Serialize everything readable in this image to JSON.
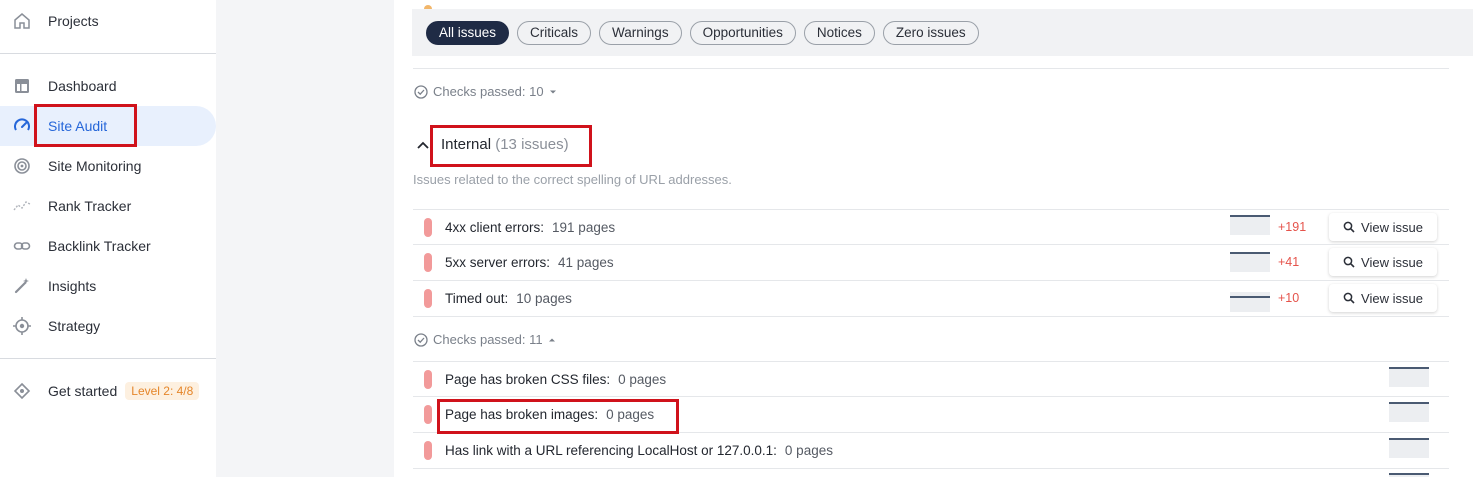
{
  "sidebar": {
    "items": [
      {
        "label": "Projects",
        "icon": "home-icon"
      },
      {
        "label": "Dashboard",
        "icon": "table-icon"
      },
      {
        "label": "Site Audit",
        "icon": "gauge-icon",
        "active": true
      },
      {
        "label": "Site Monitoring",
        "icon": "radar-icon"
      },
      {
        "label": "Rank Tracker",
        "icon": "trend-icon"
      },
      {
        "label": "Backlink Tracker",
        "icon": "link-icon"
      },
      {
        "label": "Insights",
        "icon": "magic-wand-icon"
      },
      {
        "label": "Strategy",
        "icon": "target-icon"
      },
      {
        "label": "Get started",
        "icon": "diamond-icon"
      }
    ],
    "level_badge": "Level 2: 4/8"
  },
  "filters": [
    "All issues",
    "Criticals",
    "Warnings",
    "Opportunities",
    "Notices",
    "Zero issues"
  ],
  "checks_prev": "Checks passed: 10",
  "section": {
    "title": "Internal",
    "count": "(13 issues)",
    "description": "Issues related to the correct spelling of URL addresses."
  },
  "issues": [
    {
      "label": "4xx client errors:",
      "pages": "191 pages",
      "delta": "+191"
    },
    {
      "label": "5xx server errors:",
      "pages": "41 pages",
      "delta": "+41"
    },
    {
      "label": "Timed out:",
      "pages": "10 pages",
      "delta": "+10"
    }
  ],
  "view_issue_label": "View issue",
  "checks_current": "Checks passed: 11",
  "passed": [
    {
      "label": "Page has broken CSS files:",
      "pages": "0 pages"
    },
    {
      "label": "Page has broken images:",
      "pages": "0 pages"
    },
    {
      "label": "Has link with a URL referencing LocalHost or 127.0.0.1:",
      "pages": "0 pages"
    }
  ],
  "colors": {
    "accent": "#2566d9",
    "critical": "#f29a9a",
    "delta": "#e5534b",
    "highlight": "#d0121b"
  }
}
